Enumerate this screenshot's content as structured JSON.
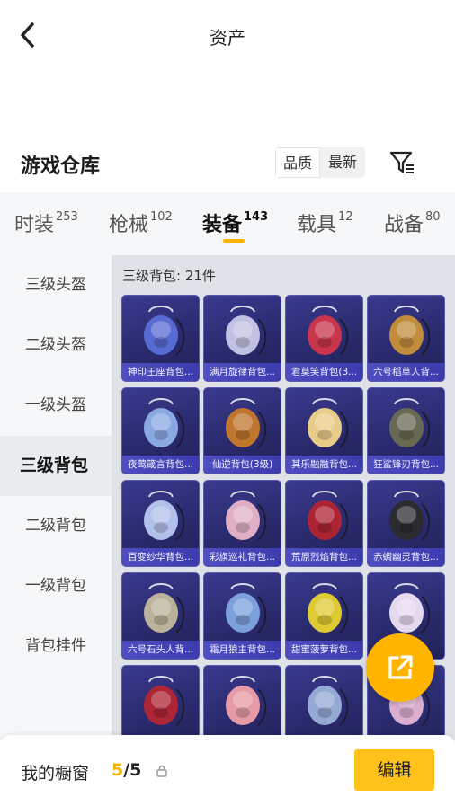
{
  "header": {
    "title": "资产",
    "back_icon": "chevron-left-icon"
  },
  "section": {
    "title": "游戏仓库",
    "sort_options": [
      "品质",
      "最新"
    ],
    "active_sort": "品质",
    "filter_icon": "filter-list-icon"
  },
  "tabs": [
    {
      "label": "时装",
      "count": "253"
    },
    {
      "label": "枪械",
      "count": "102"
    },
    {
      "label": "装备",
      "count": "143",
      "active": true
    },
    {
      "label": "载具",
      "count": "12"
    },
    {
      "label": "战备",
      "count": "80"
    }
  ],
  "sidebar": [
    {
      "label": "三级头盔"
    },
    {
      "label": "二级头盔"
    },
    {
      "label": "一级头盔"
    },
    {
      "label": "三级背包",
      "active": true
    },
    {
      "label": "二级背包"
    },
    {
      "label": "一级背包"
    },
    {
      "label": "背包挂件"
    }
  ],
  "content": {
    "subtitle": "三级背包: 21件",
    "items": [
      {
        "name": "神印王座背包...",
        "accent": "#5a6fd8"
      },
      {
        "name": "满月旋律背包...",
        "accent": "#c9c9e8"
      },
      {
        "name": "君莫笑背包(3...",
        "accent": "#d2364a"
      },
      {
        "name": "六号稻草人背...",
        "accent": "#c9923a"
      },
      {
        "name": "夜莺箴言背包...",
        "accent": "#8fb0e8"
      },
      {
        "name": "仙逆背包(3级)",
        "accent": "#c77a2a"
      },
      {
        "name": "其乐融融背包...",
        "accent": "#f2d58a"
      },
      {
        "name": "狂鲨锋刃背包...",
        "accent": "#6b6b52"
      },
      {
        "name": "百变纱华背包...",
        "accent": "#b9c8f2"
      },
      {
        "name": "彩旗巡礼背包...",
        "accent": "#e9b7c9"
      },
      {
        "name": "荒原烈焰背包...",
        "accent": "#b3232f"
      },
      {
        "name": "赤蜩幽灵背包...",
        "accent": "#2c2c2c"
      },
      {
        "name": "六号石头人背...",
        "accent": "#c2b99c"
      },
      {
        "name": "霜月狼主背包...",
        "accent": "#7fa6e0"
      },
      {
        "name": "甜蜜菠萝背包...",
        "accent": "#e8d32f"
      },
      {
        "name": "",
        "accent": "#efe3f5"
      },
      {
        "name": "",
        "accent": "#b52533"
      },
      {
        "name": "",
        "accent": "#f0a0a8"
      },
      {
        "name": "",
        "accent": "#9ab0d8"
      },
      {
        "name": "",
        "accent": "#e6b6d6"
      }
    ]
  },
  "share": {
    "icon": "share-external-icon"
  },
  "showcase": {
    "label": "我的橱窗",
    "current": "5",
    "total": "/5",
    "lock_icon": "lock-icon",
    "edit_label": "编辑"
  },
  "colors": {
    "accent": "#ffc21a",
    "highlight": "#f5b300"
  }
}
